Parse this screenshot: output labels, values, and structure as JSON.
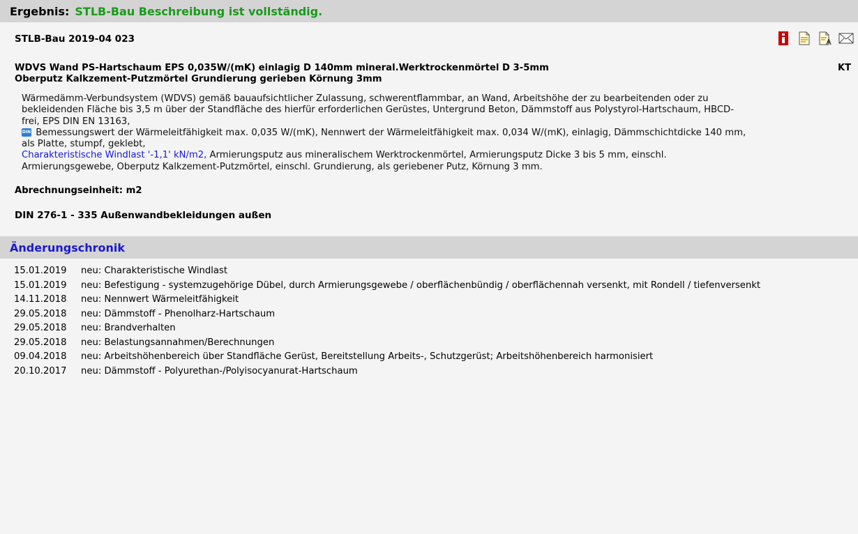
{
  "header": {
    "label": "Ergebnis:",
    "status": "STLB-Bau Beschreibung ist vollständig."
  },
  "stlb_id": "STLB-Bau 2019-04 023",
  "kurztext": {
    "line1": "WDVS Wand PS-Hartschaum EPS 0,035W/(mK) einlagig D 140mm mineral.Werktrockenmörtel D 3-5mm",
    "line2": "Oberputz Kalkzement-Putzmörtel Grundierung gerieben Körnung 3mm",
    "tag": "KT"
  },
  "langtext": {
    "part1": "Wärmedämm-Verbundsystem (WDVS) gemäß bauaufsichtlicher Zulassung, schwerentflammbar, an Wand, Arbeitshöhe der zu bearbeitenden oder zu bekleidenden Fläche bis 3,5 m über der Standfläche des hierfür erforderlichen Gerüstes, Untergrund Beton, Dämmstoff aus Polystyrol-Hartschaum, HBCD-frei, EPS DIN EN 13163,",
    "din_badge": "DIN",
    "part2": "Bemessungswert der Wärmeleitfähigkeit max. 0,035 W/(mK), Nennwert der Wärmeleitfähigkeit max. 0,034 W/(mK), einlagig, Dämmschichtdicke 140 mm, als Platte, stumpf, geklebt,",
    "highlight": "Charakteristische Windlast '-1,1' kN/m2,",
    "part3": "Armierungsputz aus mineralischem Werktrockenmörtel, Armierungsputz Dicke 3 bis 5 mm, einschl. Armierungsgewebe, Oberputz Kalkzement-Putzmörtel, einschl. Grundierung, als geriebener Putz, Körnung 3 mm."
  },
  "abrechnung": "Abrechnungseinheit: m2",
  "din276": "DIN 276-1 - 335 Außenwandbekleidungen außen",
  "chronik": {
    "title": "Änderungschronik",
    "entries": [
      {
        "date": "15.01.2019",
        "text": "neu: Charakteristische Windlast"
      },
      {
        "date": "15.01.2019",
        "text": "neu: Befestigung - systemzugehörige Dübel, durch Armierungsgewebe / oberflächenbündig / oberflächennah versenkt, mit Rondell / tiefenversenkt"
      },
      {
        "date": "14.11.2018",
        "text": "neu: Nennwert Wärmeleitfähigkeit"
      },
      {
        "date": "29.05.2018",
        "text": "neu: Dämmstoff - Phenolharz-Hartschaum"
      },
      {
        "date": "29.05.2018",
        "text": "neu: Brandverhalten"
      },
      {
        "date": "29.05.2018",
        "text": "neu: Belastungsannahmen/Berechnungen"
      },
      {
        "date": "09.04.2018",
        "text": "neu: Arbeitshöhenbereich über Standfläche Gerüst, Bereitstellung Arbeits-, Schutzgerüst; Arbeitshöhenbereich harmonisiert"
      },
      {
        "date": "20.10.2017",
        "text": "neu: Dämmstoff - Polyurethan-/Polyisocyanurat-Hartschaum"
      }
    ]
  },
  "icons": [
    "info-icon",
    "document-icon",
    "document-text-icon",
    "mail-icon"
  ]
}
